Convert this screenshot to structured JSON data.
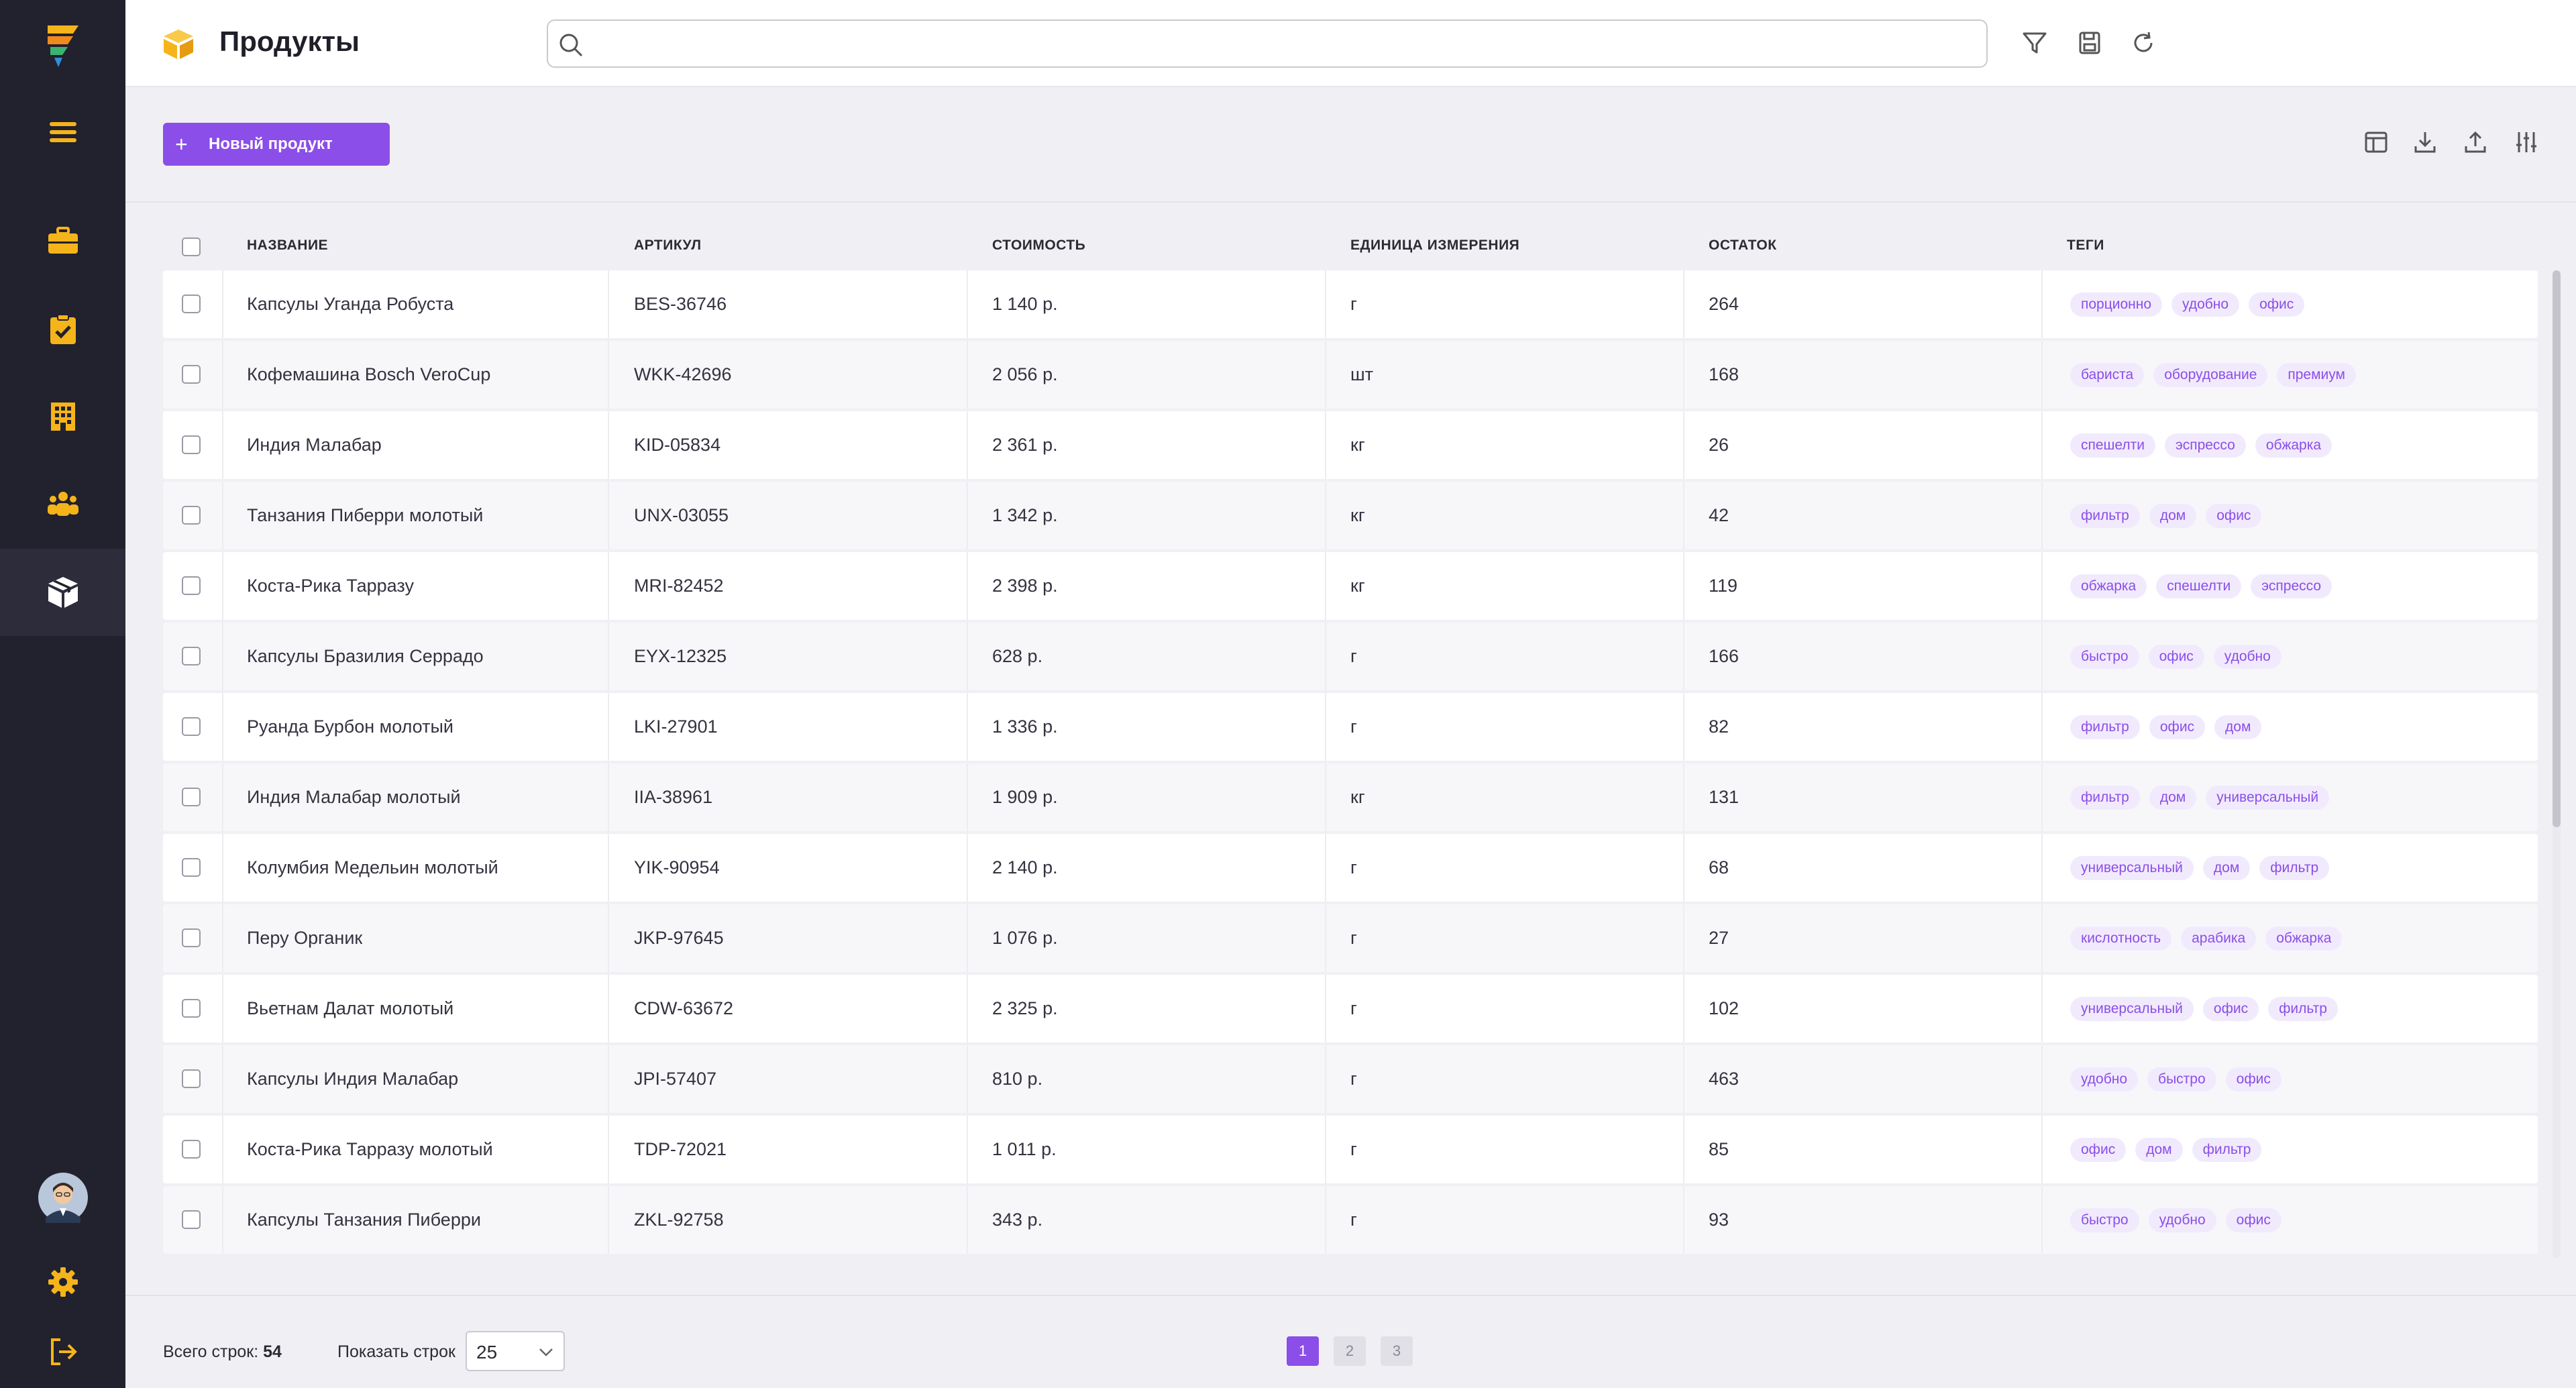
{
  "app": {
    "page_title": "Продукты",
    "accent_color": "#8b4ee8",
    "sidebar_bg": "#22212e",
    "icon_color": "#f5b41a"
  },
  "sidebar": {
    "items": [
      {
        "icon": "logo-icon"
      },
      {
        "icon": "menu-icon"
      },
      {
        "icon": "briefcase-icon"
      },
      {
        "icon": "clipboard-check-icon"
      },
      {
        "icon": "building-icon"
      },
      {
        "icon": "users-icon"
      },
      {
        "icon": "box-icon",
        "active": true
      }
    ],
    "bottom": [
      {
        "icon": "avatar"
      },
      {
        "icon": "gear-icon"
      },
      {
        "icon": "logout-icon"
      }
    ]
  },
  "search": {
    "placeholder": "",
    "value": ""
  },
  "toolbar": {
    "new_product_label": "Новый продукт"
  },
  "table": {
    "columns": [
      "НАЗВАНИЕ",
      "АРТИКУЛ",
      "СТОИМОСТЬ",
      "ЕДИНИЦА ИЗМЕРЕНИЯ",
      "ОСТАТОК",
      "ТЕГИ"
    ],
    "rows": [
      {
        "name": "Капсулы Уганда Робуста",
        "sku": "BES-36746",
        "price": "1 140 р.",
        "unit": "г",
        "stock": "264",
        "tags": [
          "порционно",
          "удобно",
          "офис"
        ]
      },
      {
        "name": "Кофемашина Bosch VeroCup",
        "sku": "WKK-42696",
        "price": "2 056 р.",
        "unit": "шт",
        "stock": "168",
        "tags": [
          "бариста",
          "оборудование",
          "премиум"
        ]
      },
      {
        "name": "Индия Малабар",
        "sku": "KID-05834",
        "price": "2 361 р.",
        "unit": "кг",
        "stock": "26",
        "tags": [
          "спешелти",
          "эспрессо",
          "обжарка"
        ]
      },
      {
        "name": "Танзания Пиберри молотый",
        "sku": "UNX-03055",
        "price": "1 342 р.",
        "unit": "кг",
        "stock": "42",
        "tags": [
          "фильтр",
          "дом",
          "офис"
        ]
      },
      {
        "name": "Коста-Рика Тарразу",
        "sku": "MRI-82452",
        "price": "2 398 р.",
        "unit": "кг",
        "stock": "119",
        "tags": [
          "обжарка",
          "спешелти",
          "эспрессо"
        ]
      },
      {
        "name": "Капсулы Бразилия Серрадо",
        "sku": "EYX-12325",
        "price": "628 р.",
        "unit": "г",
        "stock": "166",
        "tags": [
          "быстро",
          "офис",
          "удобно"
        ]
      },
      {
        "name": "Руанда Бурбон молотый",
        "sku": "LKI-27901",
        "price": "1 336 р.",
        "unit": "г",
        "stock": "82",
        "tags": [
          "фильтр",
          "офис",
          "дом"
        ]
      },
      {
        "name": "Индия Малабар молотый",
        "sku": "IIA-38961",
        "price": "1 909 р.",
        "unit": "кг",
        "stock": "131",
        "tags": [
          "фильтр",
          "дом",
          "универсальный"
        ]
      },
      {
        "name": "Колумбия Медельин молотый",
        "sku": "YIK-90954",
        "price": "2 140 р.",
        "unit": "г",
        "stock": "68",
        "tags": [
          "универсальный",
          "дом",
          "фильтр"
        ]
      },
      {
        "name": "Перу Органик",
        "sku": "JKP-97645",
        "price": "1 076 р.",
        "unit": "г",
        "stock": "27",
        "tags": [
          "кислотность",
          "арабика",
          "обжарка"
        ]
      },
      {
        "name": "Вьетнам Далат молотый",
        "sku": "CDW-63672",
        "price": "2 325 р.",
        "unit": "г",
        "stock": "102",
        "tags": [
          "универсальный",
          "офис",
          "фильтр"
        ]
      },
      {
        "name": "Капсулы Индия Малабар",
        "sku": "JPI-57407",
        "price": "810 р.",
        "unit": "г",
        "stock": "463",
        "tags": [
          "удобно",
          "быстро",
          "офис"
        ]
      },
      {
        "name": "Коста-Рика Тарразу молотый",
        "sku": "TDP-72021",
        "price": "1 011 р.",
        "unit": "г",
        "stock": "85",
        "tags": [
          "офис",
          "дом",
          "фильтр"
        ]
      },
      {
        "name": "Капсулы Танзания Пиберри",
        "sku": "ZKL-92758",
        "price": "343 р.",
        "unit": "г",
        "stock": "93",
        "tags": [
          "быстро",
          "удобно",
          "офис"
        ]
      }
    ]
  },
  "footer": {
    "total_label": "Всего строк:",
    "total_value": "54",
    "show_rows_label": "Показать строк",
    "rows_per_page": "25",
    "pages": [
      "1",
      "2",
      "3"
    ],
    "current_page": "1"
  }
}
